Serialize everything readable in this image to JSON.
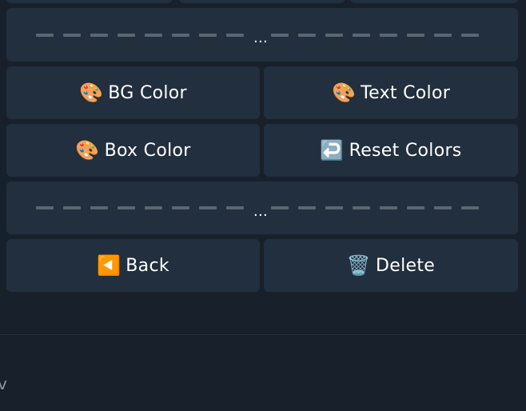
{
  "colors": {
    "button_bg": "#212f3e",
    "page_bg": "#18212b",
    "text": "#ffffff",
    "dash": "#5c6670"
  },
  "keyboard": {
    "separator_label": "...",
    "rows": [
      {
        "buttons": [
          {
            "icon": "palette-icon",
            "emoji": "🎨",
            "label": "BG Color"
          },
          {
            "icon": "palette-icon",
            "emoji": "🎨",
            "label": "Text Color"
          }
        ]
      },
      {
        "buttons": [
          {
            "icon": "palette-icon",
            "emoji": "🎨",
            "label": "Box Color"
          },
          {
            "icon": "return-arrow-icon",
            "emoji": "↩️",
            "label": "Reset Colors"
          }
        ]
      },
      {
        "buttons": [
          {
            "icon": "back-icon",
            "emoji": "◀️",
            "label": "Back"
          },
          {
            "icon": "trash-icon",
            "emoji": "🗑️",
            "label": "Delete"
          }
        ]
      }
    ]
  },
  "input_edge_glyph": "v"
}
